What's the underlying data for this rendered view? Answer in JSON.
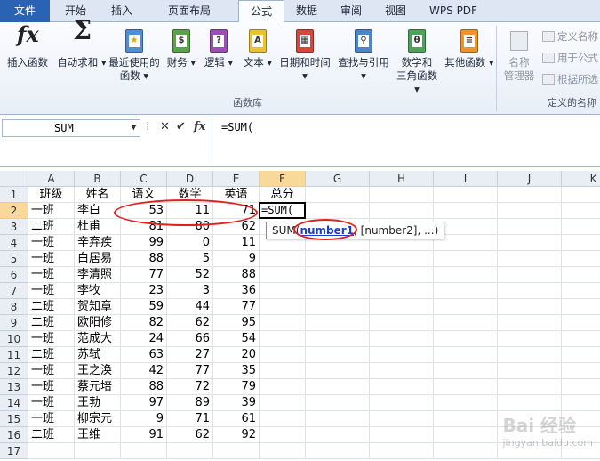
{
  "tabs": [
    "文件",
    "开始",
    "插入",
    "页面布局",
    "公式",
    "数据",
    "审阅",
    "视图",
    "WPS PDF"
  ],
  "active_tab": "公式",
  "ribbon": {
    "insert_function": "插入函数",
    "autosum": "自动求和",
    "recent": [
      "最近使用的",
      "函数"
    ],
    "finance": "财务",
    "logic": "逻辑",
    "text": "文本",
    "datetime": "日期和时间",
    "lookup": "查找与引用",
    "math": [
      "数学和",
      "三角函数"
    ],
    "other": "其他函数",
    "group_label": "函数库",
    "name_manager": [
      "名称",
      "管理器"
    ],
    "define_name": "定义名称",
    "use_in_formula": "用于公式",
    "create_from_selection": "根据所选",
    "defined_names_label": "定义的名称"
  },
  "formula_bar": {
    "name_box": "SUM",
    "buttons": [
      "✕",
      "✔",
      "fx"
    ],
    "formula": "=SUM("
  },
  "columns": [
    "A",
    "B",
    "C",
    "D",
    "E",
    "F",
    "G",
    "H",
    "I",
    "J",
    "K"
  ],
  "rows": [
    "1",
    "2",
    "3",
    "4",
    "5",
    "6",
    "7",
    "8",
    "9",
    "10",
    "11",
    "12",
    "13",
    "14",
    "15",
    "16",
    "17"
  ],
  "header_row": [
    "班级",
    "姓名",
    "语文",
    "数学",
    "英语",
    "总分"
  ],
  "table_rows": [
    [
      "一班",
      "李白",
      "53",
      "11",
      "71"
    ],
    [
      "二班",
      "杜甫",
      "81",
      "80",
      "62"
    ],
    [
      "一班",
      "辛弃疾",
      "99",
      "0",
      "11"
    ],
    [
      "一班",
      "白居易",
      "88",
      "5",
      "9"
    ],
    [
      "一班",
      "李清照",
      "77",
      "52",
      "88"
    ],
    [
      "一班",
      "李牧",
      "23",
      "3",
      "36"
    ],
    [
      "二班",
      "贺知章",
      "59",
      "44",
      "77"
    ],
    [
      "二班",
      "欧阳修",
      "82",
      "62",
      "95"
    ],
    [
      "一班",
      "范成大",
      "24",
      "66",
      "54"
    ],
    [
      "二班",
      "苏轼",
      "63",
      "27",
      "20"
    ],
    [
      "一班",
      "王之涣",
      "42",
      "77",
      "35"
    ],
    [
      "一班",
      "蔡元培",
      "88",
      "72",
      "79"
    ],
    [
      "一班",
      "王勃",
      "97",
      "89",
      "39"
    ],
    [
      "一班",
      "柳宗元",
      "9",
      "71",
      "61"
    ],
    [
      "二班",
      "王维",
      "91",
      "62",
      "92"
    ]
  ],
  "active_cell_text": "=SUM(",
  "tooltip": {
    "prefix": "SUM(",
    "current_arg": "number1",
    "rest": ", [number2], ...)"
  },
  "watermark": {
    "text": "Bai 经验",
    "sub": "jingyan.baidu.com"
  },
  "colors": {
    "accent": "#2a63b4",
    "highlight": "#e0201e",
    "selected_header": "#f9d99a"
  }
}
